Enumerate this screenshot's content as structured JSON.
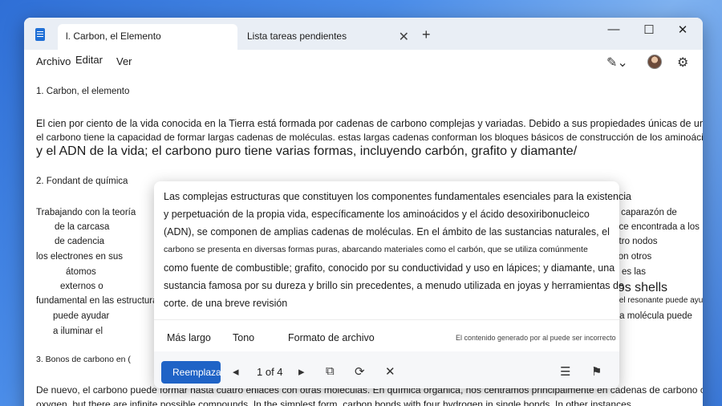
{
  "window": {
    "tabs": [
      {
        "label": "l. Carbon, el Elemento"
      },
      {
        "label": "Lista tareas pendientes"
      }
    ]
  },
  "menu": {
    "items": [
      "Archivo",
      "Editar",
      "Ver"
    ]
  },
  "document": {
    "heading1": "1. Carbon, el elemento",
    "p1_line1": "El cien por ciento de la vida conocida en la Tierra está formada por cadenas de carbono complejas y variadas. Debido a sus propiedades únicas de unión,",
    "p1_line2": "el carbono tiene la capacidad de formar largas cadenas de moléculas. estas largas cadenas conforman los bloques básicos de construcción de los aminoácidos",
    "p1_line3": "y el ADN de la vida; el carbono puro tiene varias formas, incluyendo carbón, grafito y diamante/",
    "heading2": "2.   Fondant de química",
    "left_fragments": [
      "Trabajando con la teoría",
      "de la carcasa",
      "de cadencia",
      "los electrones en sus",
      "átomos",
      "externos o",
      "fundamental en las estructuras)",
      "puede ayudar",
      "a iluminar el"
    ],
    "right_fragments": [
      "de la caparazón de",
      "valence encontrada a los",
      "cuatro nodos",
      "con otros",
      "es las",
      "en los shells",
      "de betel resonante puede ayudar",
      "es una molécula puede"
    ],
    "heading3": "3.  Bonos de carbono en (",
    "p3_line1": "De nuevo, el carbono puede formar hasta cuatro enlaces con otras moléculas. En química orgánica, nos centramos principalmente en cadenas de carbono con hidrógeno y",
    "p3_line2": "oxygen, but there are infinite possible compounds. In the simplest form, carbon bonds with four hydrogen in single bonds. In other instances"
  },
  "rewrite": {
    "lines": [
      "Las complejas estructuras que constituyen los componentes fundamentales esenciales para la existencia",
      "y perpetuación de la propia vida, específicamente los aminoácidos y el ácido desoxiribonucleico",
      "(ADN), se componen de amplias cadenas de moléculas. En el ámbito de las sustancias naturales, el",
      "carbono se presenta en diversas formas puras, abarcando materiales como el carbón, que se utiliza comúnmente",
      "como fuente de combustible; grafito, conocido por su conductividad y uso en lápices; y diamante, una",
      "sustancia famosa por su dureza y brillo sin precedentes, a menudo utilizada en joyas y herramientas de",
      "corte. de una breve revisión"
    ],
    "options": [
      "Más largo",
      "Tono",
      "Formato de archivo"
    ],
    "disclaimer": "El contenido generado por al puede ser incorrecto",
    "replace_label": "Reemplazar",
    "pager": "1 of 4"
  },
  "icons": {
    "app": "notepad-icon",
    "prev": "chevron-left-icon",
    "next": "chevron-right-icon"
  },
  "colors": {
    "accent": "#1f63c6"
  }
}
